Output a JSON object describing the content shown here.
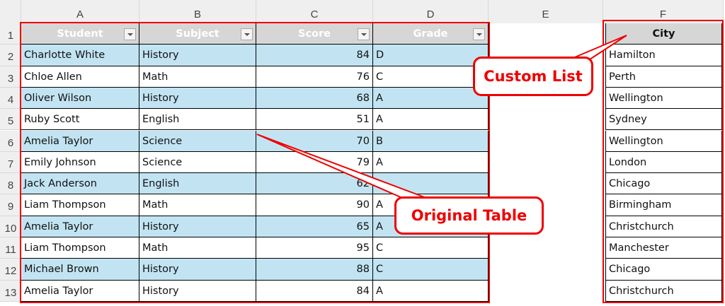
{
  "columns": [
    "A",
    "B",
    "C",
    "D",
    "E",
    "F"
  ],
  "rows": [
    "1",
    "2",
    "3",
    "4",
    "5",
    "6",
    "7",
    "8",
    "9",
    "10",
    "11",
    "12",
    "13"
  ],
  "table": {
    "headers": [
      "Student",
      "Subject",
      "Score",
      "Grade"
    ],
    "data": [
      [
        "Charlotte White",
        "History",
        "84",
        "D"
      ],
      [
        "Chloe Allen",
        "Math",
        "76",
        "C"
      ],
      [
        "Oliver Wilson",
        "History",
        "68",
        "A"
      ],
      [
        "Ruby Scott",
        "English",
        "51",
        "A"
      ],
      [
        "Amelia Taylor",
        "Science",
        "70",
        "B"
      ],
      [
        "Emily Johnson",
        "Science",
        "79",
        "A"
      ],
      [
        "Jack Anderson",
        "English",
        "62",
        ""
      ],
      [
        "Liam Thompson",
        "Math",
        "90",
        "A"
      ],
      [
        "Amelia Taylor",
        "History",
        "65",
        "A"
      ],
      [
        "Liam Thompson",
        "Math",
        "95",
        "C"
      ],
      [
        "Michael Brown",
        "History",
        "88",
        "C"
      ],
      [
        "Amelia Taylor",
        "History",
        "84",
        "A"
      ]
    ]
  },
  "city_list": {
    "header": "City",
    "items": [
      "Hamilton",
      "Perth",
      "Wellington",
      "Sydney",
      "Wellington",
      "London",
      "Chicago",
      "Birmingham",
      "Christchurch",
      "Manchester",
      "Chicago",
      "Christchurch"
    ]
  },
  "callouts": {
    "custom_list": "Custom List",
    "original_table": "Original Table"
  },
  "colors": {
    "accent": "#e00000",
    "band": "#c2e4f2",
    "header": "#d6d6d6"
  }
}
